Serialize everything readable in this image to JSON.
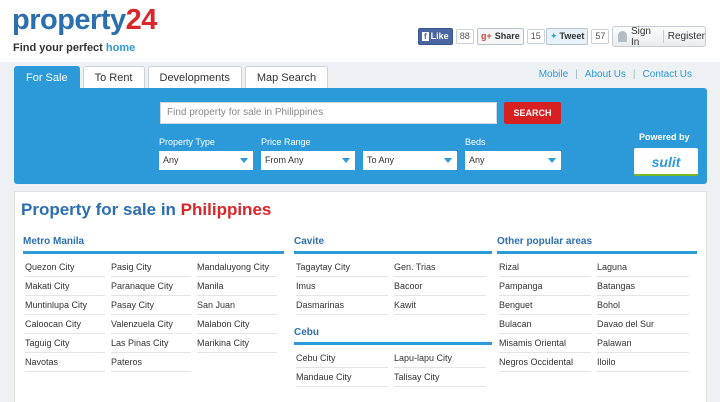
{
  "header": {
    "logo_main": "property",
    "logo_num": "24",
    "tagline_main": "Find your perfect",
    "tagline_home": "home",
    "facebook": {
      "label": "Like",
      "count": "88"
    },
    "googleplus": {
      "label": "Share",
      "count": "15"
    },
    "twitter": {
      "label": "Tweet",
      "count": "57"
    },
    "sign_in": "Sign In",
    "register": "Register"
  },
  "tabs": [
    "For Sale",
    "To Rent",
    "Developments",
    "Map Search"
  ],
  "top_links": [
    "Mobile",
    "About Us",
    "Contact Us"
  ],
  "search": {
    "placeholder": "Find property for sale in Philippines",
    "button": "SEARCH",
    "filters": [
      {
        "label": "Property Type",
        "value": "Any"
      },
      {
        "label": "Price Range",
        "value": "From Any"
      },
      {
        "label": "",
        "value": "To Any"
      },
      {
        "label": "Beds",
        "value": "Any"
      }
    ],
    "powered_by": "Powered by",
    "partner": "sulit"
  },
  "content": {
    "title_main": "Property for sale in",
    "title_place": "Philippines",
    "sections": [
      {
        "title": "Metro Manila",
        "cities": [
          "Quezon City",
          "Makati City",
          "Muntinlupa City",
          "Caloocan City",
          "Taguig City",
          "Navotas",
          "Pasig City",
          "Paranaque City",
          "Pasay City",
          "Valenzuela City",
          "Las Pinas City",
          "Pateros",
          "Mandaluyong City",
          "Manila",
          "San Juan",
          "Malabon City",
          "Marikina City"
        ]
      },
      {
        "title": "Cavite",
        "cities": [
          "Tagaytay City",
          "Imus",
          "Dasmarinas",
          "Gen. Trias",
          "Bacoor",
          "Kawit"
        ]
      },
      {
        "title": "Cebu",
        "cities": [
          "Cebu City",
          "Mandaue City",
          "Lapu-lapu City",
          "Talisay City"
        ]
      },
      {
        "title": "Other popular areas",
        "cities": [
          "Rizal",
          "Pampanga",
          "Benguet",
          "Bulacan",
          "Misamis Oriental",
          "Negros Occidental",
          "Laguna",
          "Batangas",
          "Bohol",
          "Davao del Sur",
          "Palawan",
          "Iloilo"
        ]
      }
    ]
  }
}
